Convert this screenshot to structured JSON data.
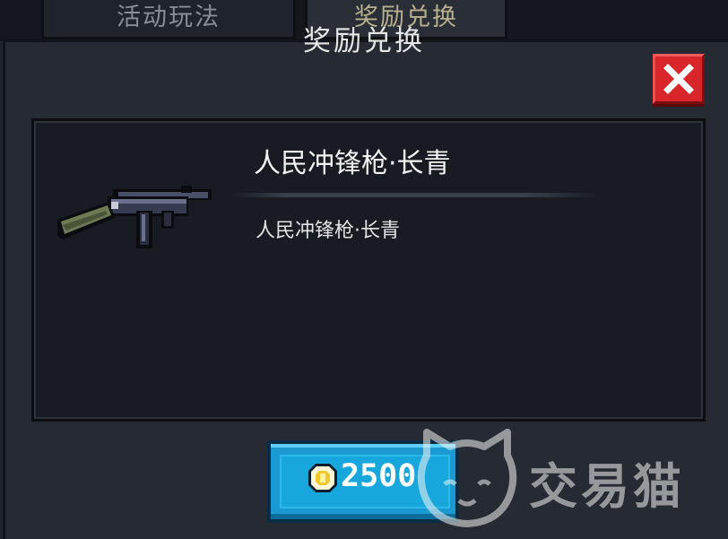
{
  "tabs": [
    {
      "label": "活动玩法"
    },
    {
      "label": "奖励兑换"
    }
  ],
  "dialog": {
    "title": "奖励兑换",
    "item_name": "人民冲锋枪·长青",
    "item_description": "人民冲锋枪·长青"
  },
  "buy_button": {
    "price": "2500",
    "currency_icon": "gem-coin-icon"
  },
  "watermark": {
    "text": "交易猫"
  },
  "colors": {
    "close_button": "#d8262a",
    "buy_button": "#1a9ad0",
    "panel": "#262a33"
  }
}
